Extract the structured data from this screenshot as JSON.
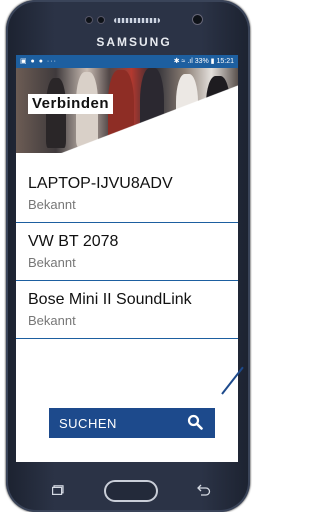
{
  "device_brand": "SAMSUNG",
  "status_bar": {
    "left_icons": "▣ ● ● ···",
    "right_text": "✱ ≈ .ıl 33% ▮ 15:21"
  },
  "screen": {
    "title": "Verbinden",
    "devices": [
      {
        "name": "LAPTOP-IJVU8ADV",
        "status": "Bekannt"
      },
      {
        "name": "VW BT 2078",
        "status": "Bekannt"
      },
      {
        "name": "Bose Mini II SoundLink",
        "status": "Bekannt"
      }
    ],
    "search_button": {
      "label": "SUCHEN",
      "icon": "search-icon"
    }
  },
  "colors": {
    "accent": "#1d5fa0",
    "button": "#1d4a8c"
  }
}
